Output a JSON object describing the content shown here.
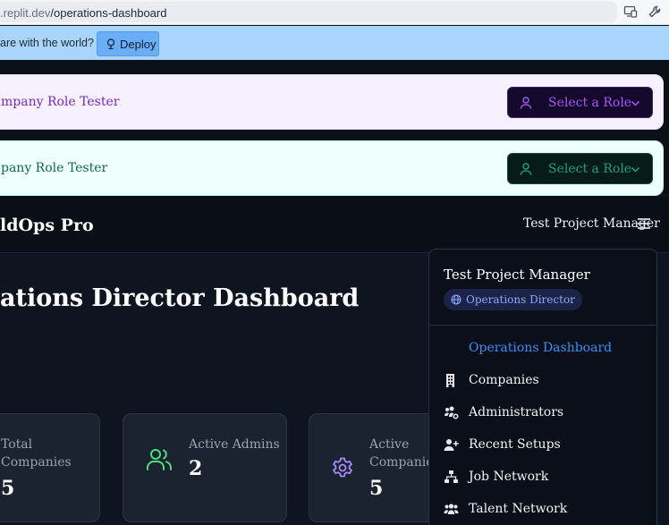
{
  "browser": {
    "url_prefix": ".replit.dev",
    "url_path": "/operations-dashboard"
  },
  "banner": {
    "text": "are with the world?",
    "deploy_label": "Deploy"
  },
  "testers": [
    {
      "label": "mpany Role Tester",
      "select_placeholder": "Select a Role"
    },
    {
      "label": "pany Role Tester",
      "select_placeholder": "Select a Role"
    }
  ],
  "header": {
    "brand": "ldOps Pro",
    "user_name": "Test Project Manager"
  },
  "page": {
    "title": "ations Director Dashboard"
  },
  "stats": [
    {
      "label_line1": "Total",
      "label_line2": "Companies",
      "value": "5"
    },
    {
      "label_line1": "Active Admins",
      "label_line2": "",
      "value": "2"
    },
    {
      "label_line1": "Active",
      "label_line2": "Companies",
      "value": "5"
    }
  ],
  "dropdown": {
    "name": "Test Project Manager",
    "role_badge": "Operations Director",
    "items": [
      {
        "label": "Operations Dashboard",
        "icon": "none",
        "active": true
      },
      {
        "label": "Companies",
        "icon": "building-icon"
      },
      {
        "label": "Administrators",
        "icon": "users-cog-icon"
      },
      {
        "label": "Recent Setups",
        "icon": "user-plus-icon"
      },
      {
        "label": "Job Network",
        "icon": "network-icon"
      },
      {
        "label": "Talent Network",
        "icon": "users-icon"
      }
    ]
  },
  "colors": {
    "accent_blue": "#3b8ff6",
    "purple": "#a855f7",
    "teal": "#16a079",
    "green_icon": "#4ade80",
    "violet_icon": "#a78bfa"
  }
}
